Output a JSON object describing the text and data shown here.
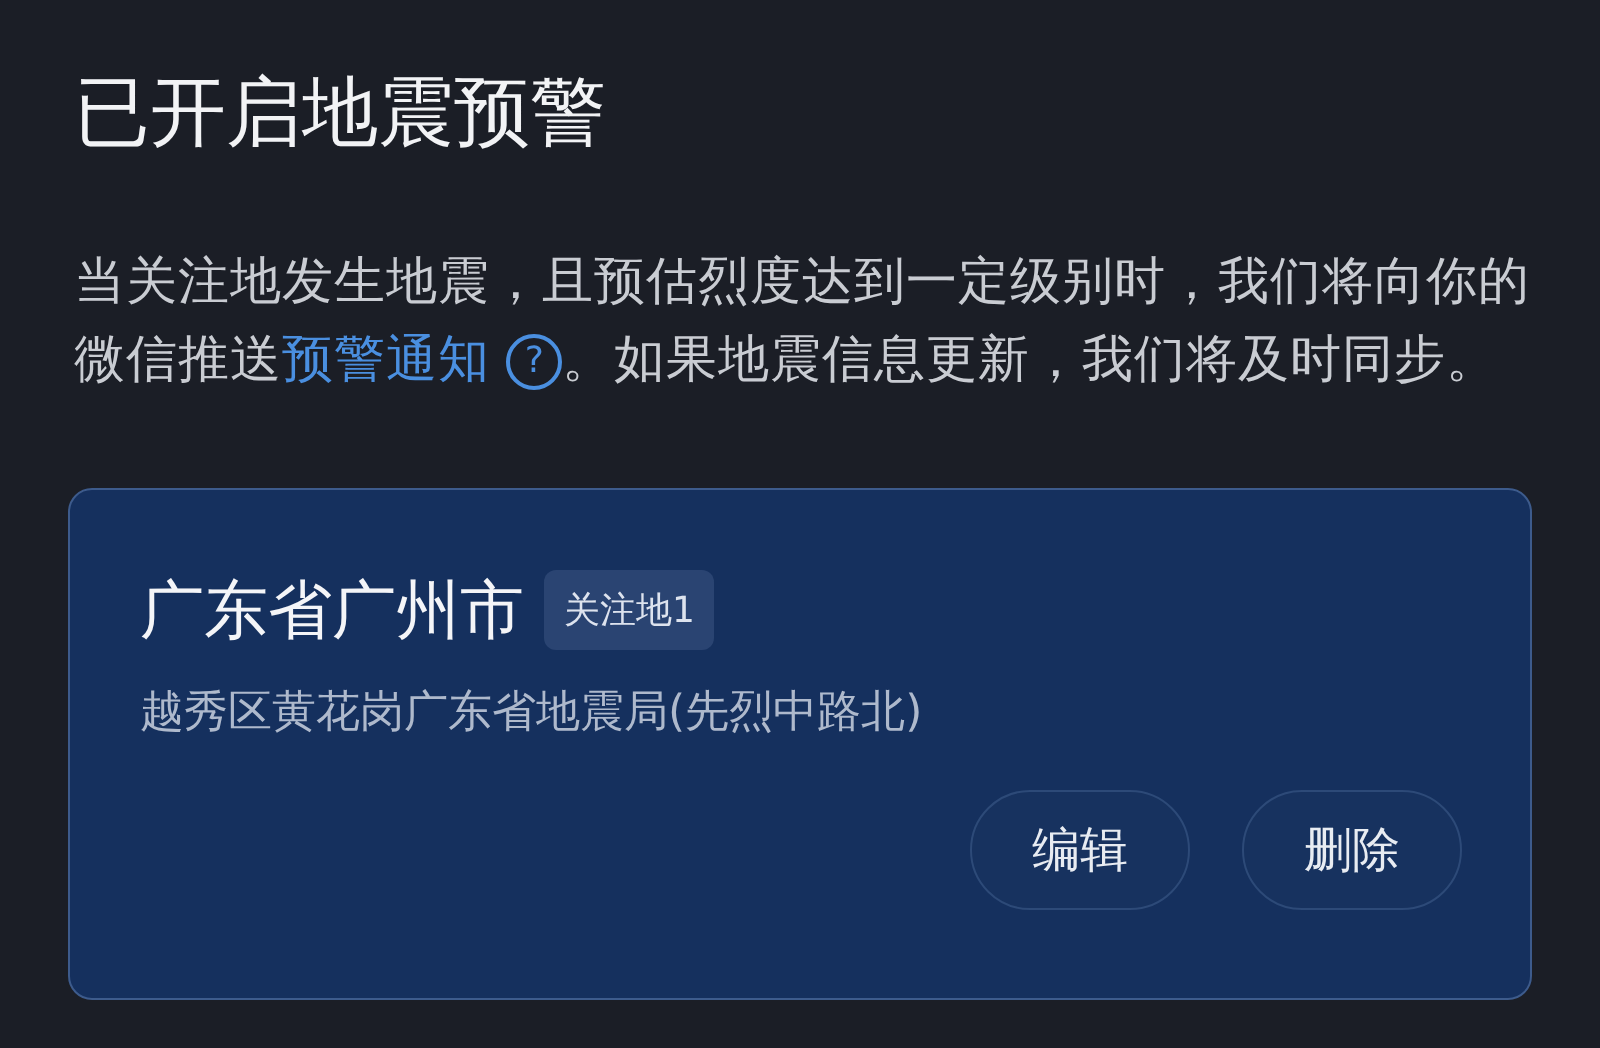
{
  "title": "已开启地震预警",
  "description": {
    "before": "当关注地发生地震，且预估烈度达到一定级别时，我们将向你的微信推送",
    "link": "预警通知",
    "help": "?",
    "after": "。如果地震信息更新，我们将及时同步。"
  },
  "locations": [
    {
      "city": "广东省广州市",
      "tag": "关注地1",
      "address": "越秀区黄花岗广东省地震局(先烈中路北)",
      "buttons": [
        "编辑",
        "删除"
      ]
    }
  ]
}
